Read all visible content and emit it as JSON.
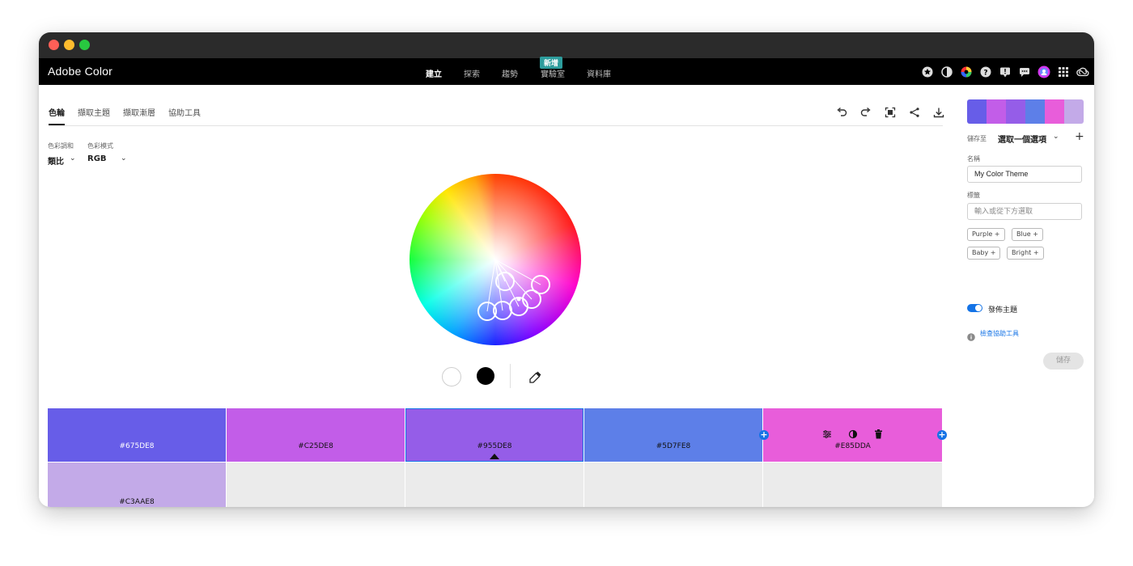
{
  "colors": {
    "titlebar": "#2b2b2b",
    "appbar": "#000000",
    "accent_blue": "#1473e6",
    "new_badge": "#2d9d9d",
    "traffic_red": "#ff5f57",
    "traffic_yellow": "#febc2e",
    "traffic_green": "#28c840"
  },
  "app": {
    "title": "Adobe Color",
    "nav": [
      {
        "label": "建立",
        "active": true
      },
      {
        "label": "探索",
        "active": false
      },
      {
        "label": "趨勢",
        "active": false
      },
      {
        "label": "實驗室",
        "active": false
      },
      {
        "label": "資料庫",
        "active": false
      }
    ],
    "new_badge": "新增",
    "top_icons": [
      "star-icon",
      "contrast-icon",
      "color-wheel-icon",
      "help-icon",
      "alert-icon",
      "feedback-icon",
      "avatar-icon",
      "apps-grid-icon",
      "creative-cloud-icon"
    ]
  },
  "tabs": [
    {
      "label": "色輪",
      "active": true
    },
    {
      "label": "擷取主題",
      "active": false
    },
    {
      "label": "擷取漸層",
      "active": false
    },
    {
      "label": "協助工具",
      "active": false
    }
  ],
  "toolbar": [
    "undo-icon",
    "redo-icon",
    "fullscreen-icon",
    "share-icon",
    "download-icon"
  ],
  "controls": {
    "harmony_label": "色彩調和",
    "harmony_value": "類比",
    "mode_label": "色彩模式",
    "mode_value": "RGB"
  },
  "palette": [
    {
      "hex": "#675DE8",
      "label": "#675DE8",
      "text_color": "#ffffff"
    },
    {
      "hex": "#C25DE8",
      "label": "#C25DE8",
      "text_color": "#111111"
    },
    {
      "hex": "#955DE8",
      "label": "#955DE8",
      "text_color": "#111111"
    },
    {
      "hex": "#5D7FE8",
      "label": "#5D7FE8",
      "text_color": "#111111"
    },
    {
      "hex": "#E85DDA",
      "label": "#E85DDA",
      "text_color": "#111111"
    }
  ],
  "palette_row2": [
    {
      "hex": "#C3AAE8",
      "label": "#C3AAE8"
    }
  ],
  "selected_swatch_index": 2,
  "sidebar": {
    "save_to_label": "儲存至",
    "save_to_value": "選取一個選項",
    "name_label": "名稱",
    "name_value": "My Color Theme",
    "tags_label": "標籤",
    "tags_placeholder": "輸入或從下方選取",
    "tags": [
      "Purple +",
      "Blue +",
      "Baby +",
      "Bright +"
    ],
    "publish_label": "發佈主題",
    "publish_on": true,
    "check_accessibility": "檢查協助工具",
    "save_button": "儲存"
  }
}
